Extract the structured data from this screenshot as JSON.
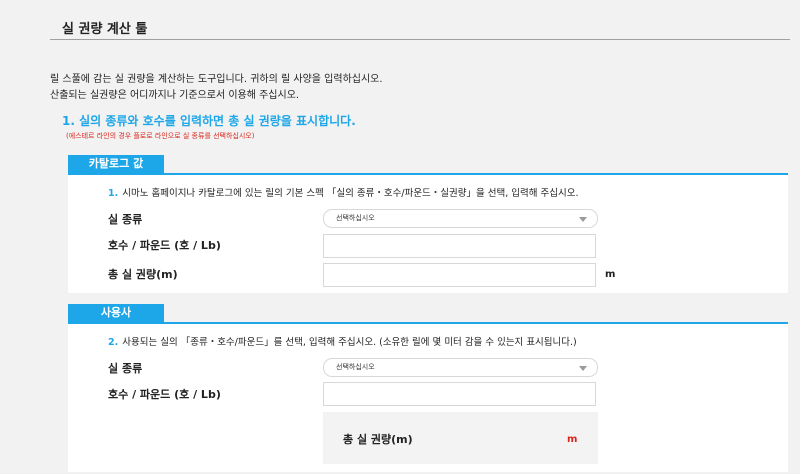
{
  "page": {
    "title": "실 권량 계산 툴",
    "intro_line1": "릴 스풀에 감는 실 권량을 계산하는 도구입니다. 귀하의 릴 사양을 입력하십시오.",
    "intro_line2": "산출되는 실권량은 어디까지나 기준으로서 이용해 주십시오.",
    "heading": "1. 실의 종류와 호수를 입력하면 총 실 권량을 표시합니다.",
    "note": "(에스테르 라인의 경우 플로로 라인으로 실 종류를 선택하십시오)"
  },
  "catalog": {
    "tab_label": "카탈로그 값",
    "instruction_number": "1.",
    "instruction_text": "시마노 홈페이지나 카탈로그에 있는 릴의 기본 스펙 「실의 종류・호수/파운드・실권량」을 선택, 입력해 주십시오.",
    "line_type_label": "실 종류",
    "line_type_value": "선택하십시오",
    "number_label": "호수 / 파운드 (호 / Lb)",
    "number_value": "",
    "total_label": "총 실 권량(m)",
    "total_value": "",
    "total_unit": "m"
  },
  "usage": {
    "tab_label": "사용사",
    "instruction_number": "2.",
    "instruction_text": "사용되는 실의 「종류・호수/파운드」를 선택, 입력해 주십시오. (소유한 릴에 몇 미터 감을 수 있는지 표시됩니다.)",
    "line_type_label": "실 종류",
    "line_type_value": "선택하십시오",
    "number_label": "호수 / 파운드 (호 / Lb)",
    "number_value": "",
    "result_label": "총 실 권량(m)",
    "result_unit": "m"
  },
  "colors": {
    "accent": "#1ea7e8",
    "warning": "#d9261c",
    "background": "#f2f2f2"
  }
}
